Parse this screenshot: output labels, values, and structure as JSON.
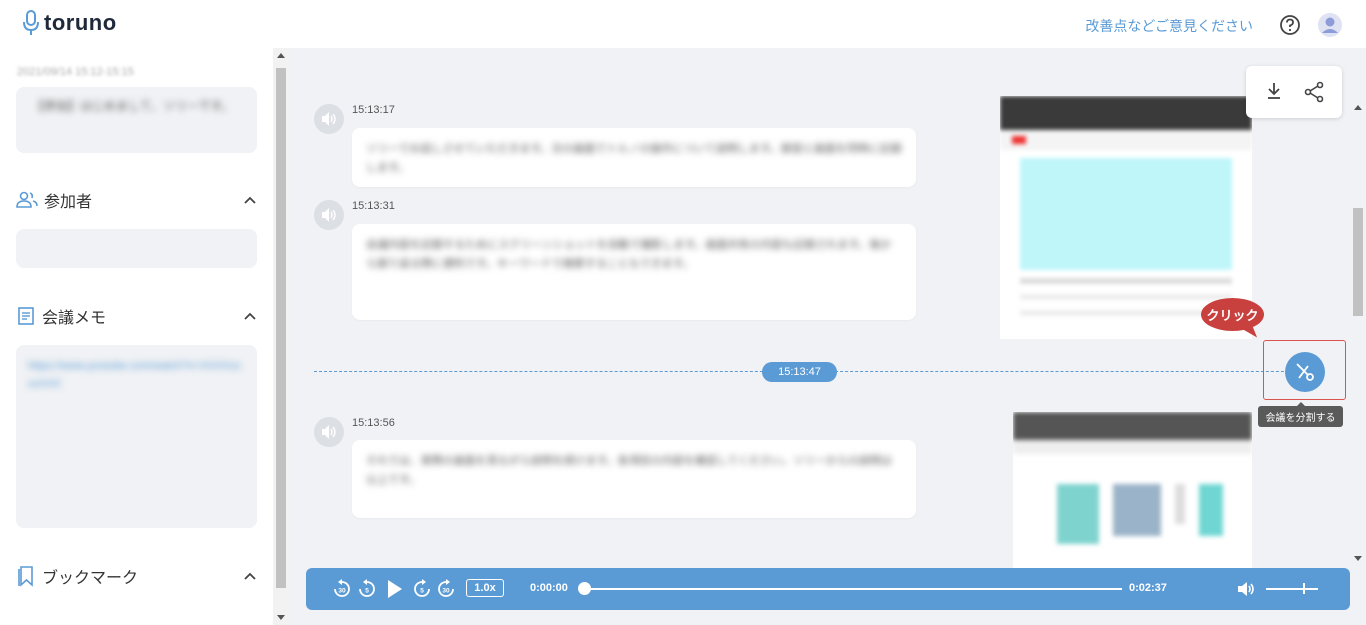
{
  "header": {
    "logo_text": "toruno",
    "feedback_link": "改善点などご意見ください"
  },
  "sidebar": {
    "datetime": "2021/09/14 15:12-15:15",
    "meeting_title": "【参加】はじめまして、ソリーです。",
    "participants_label": "参加者",
    "memo_label": "会議メモ",
    "memo_text": "https://www.youtube.com/watch?v=XXXXxxxxXXX",
    "bookmark_label": "ブックマーク"
  },
  "transcript": [
    {
      "time": "15:13:17",
      "text": "ソリーでお話しさせていただきます。次の画面でトルノの操作について説明します。録音と画面を同時に記録します。"
    },
    {
      "time": "15:13:31",
      "text": "会議内容を記録するためにスクリーンショットを自動で撮影します。画面共有の内容も記録されます。後から振り返る際に便利です。キーワードで検索することもできます。"
    },
    {
      "time": "15:13:56",
      "text": "それでは、実際の画面を見ながら説明を続けます。各項目の内容を確認してください。ソリーからの説明は以上です。"
    }
  ],
  "split": {
    "time": "15:13:47",
    "callout": "クリック",
    "tooltip": "会議を分割する"
  },
  "player": {
    "speed": "1.0x",
    "current_time": "0:00:00",
    "total_time": "0:02:37",
    "progress": 0
  },
  "colors": {
    "accent": "#5b9bd5",
    "callout": "#c9413f"
  }
}
